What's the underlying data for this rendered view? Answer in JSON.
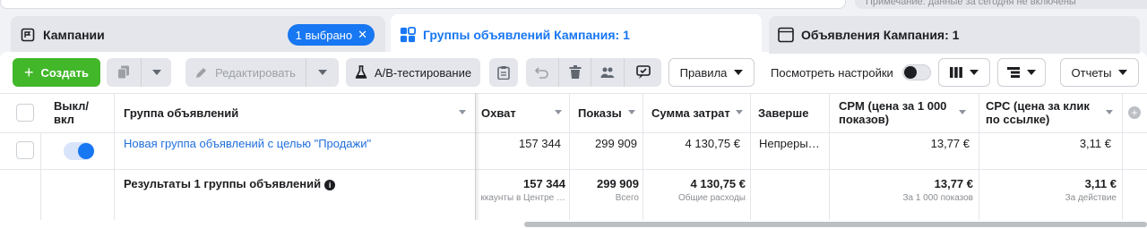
{
  "top": {
    "search_placeholder": "",
    "note": "Примечание: данные за сегодня не включены"
  },
  "tabs": {
    "campaigns": {
      "label": "Кампании",
      "selected_badge": "1 выбрано"
    },
    "adsets": {
      "label": "Группы объявлений Кампания: 1"
    },
    "ads": {
      "label": "Объявления Кампания: 1"
    }
  },
  "toolbar": {
    "create": "Создать",
    "edit": "Редактировать",
    "ab_test": "A/B-тестирование",
    "rules": "Правила",
    "view_settings": "Посмотреть настройки",
    "reports": "Отчеты"
  },
  "table": {
    "headers": {
      "onoff": "Выкл/ вкл",
      "adset": "Группа объявлений",
      "reach": "Охват",
      "impressions": "Показы",
      "spend": "Сумма затрат",
      "ends": "Заверше",
      "cpm": "CPM (цена за 1 000 показов)",
      "cpc": "CPC (цена за клик по ссылке)"
    },
    "row": {
      "name": "Новая группа объявлений с целью \"Продажи\"",
      "reach": "157 344",
      "impressions": "299 909",
      "spend": "4 130,75 €",
      "ends": "Непреры…",
      "cpm": "13,77 €",
      "cpc": "3,11 €"
    },
    "totals": {
      "label": "Результаты 1 группы объявлений",
      "reach": "157 344",
      "reach_sub": "ккаунты в Центре …",
      "impressions": "299 909",
      "impressions_sub": "Всего",
      "spend": "4 130,75 €",
      "spend_sub": "Общие расходы",
      "cpm": "13,77 €",
      "cpm_sub": "За 1 000 показов",
      "cpc": "3,11 €",
      "cpc_sub": "За действие"
    }
  },
  "colors": {
    "accent": "#1877f2",
    "create_green": "#42b72a",
    "link": "#216fdb"
  }
}
